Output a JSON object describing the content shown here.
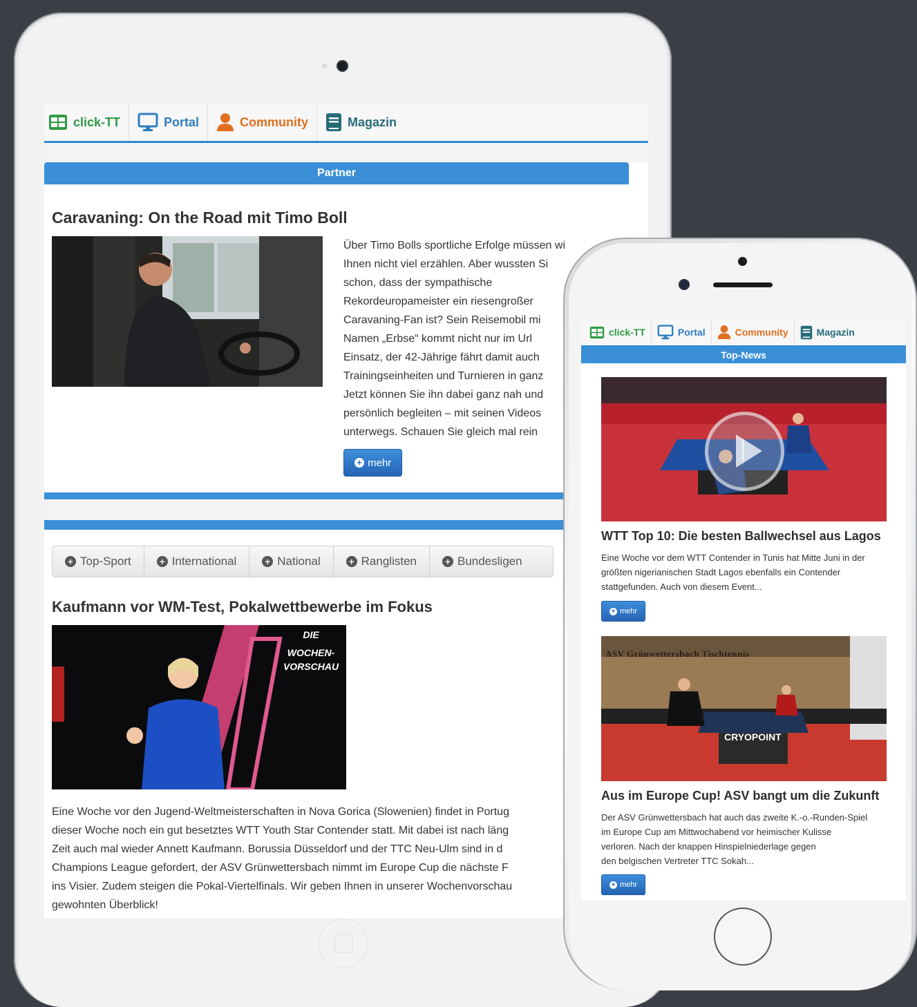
{
  "nav": {
    "items": [
      {
        "label": "click-TT",
        "icon": "grid-icon",
        "color": "#2e9a44"
      },
      {
        "label": "Portal",
        "icon": "monitor-icon",
        "color": "#2e7dbf"
      },
      {
        "label": "Community",
        "icon": "user-icon",
        "color": "#e06f1f"
      },
      {
        "label": "Magazin",
        "icon": "book-icon",
        "color": "#276b7a"
      }
    ]
  },
  "tablet": {
    "partner_header": "Partner",
    "article1": {
      "title": "Caravaning: On the Road mit Timo Boll",
      "lines": [
        "Über Timo Bolls sportliche Erfolge müssen wi",
        "Ihnen nicht viel erzählen. Aber wussten Si",
        "schon, dass der sympathische",
        "Rekordeuropameister ein riesengroßer",
        "Caravaning-Fan ist? Sein Reisemobil mi",
        "Namen „Erbse“ kommt nicht nur im Url",
        "Einsatz, der 42-Jährige fährt damit auch",
        "Trainingseinheiten und Turnieren in ganz",
        "Jetzt können Sie ihn dabei ganz nah und",
        "persönlich begleiten – mit seinen Videos",
        "unterwegs. Schauen Sie gleich mal rein"
      ],
      "button": "mehr"
    },
    "tabs": [
      "Top-Sport",
      "International",
      "National",
      "Ranglisten",
      "Bundesligen"
    ],
    "article2": {
      "title": "Kaufmann vor WM-Test, Pokalwettbewerbe im Fokus",
      "image_caption": [
        "DIE",
        "WOCHEN-",
        "VORSCHAU"
      ],
      "lines": [
        "Eine Woche vor den Jugend-Weltmeisterschaften in Nova Gorica (Slowenien) findet in Portug",
        "dieser Woche noch ein gut besetztes WTT Youth Star Contender statt. Mit dabei ist nach läng",
        "Zeit auch mal wieder Annett Kaufmann. Borussia Düsseldorf und der TTC Neu-Ulm sind in d",
        "Champions League gefordert, der ASV Grünwettersbach nimmt im Europe Cup die nächste F",
        "ins Visier. Zudem steigen die Pokal-Viertelfinals. Wir geben Ihnen in unserer Wochenvorschau",
        "gewohnten Überblick!"
      ]
    }
  },
  "phone": {
    "header": "Top-News",
    "news": [
      {
        "title": "WTT Top 10: Die besten Ballwechsel aus Lagos",
        "lines": [
          "Eine Woche vor dem WTT Contender in Tunis hat Mitte Juni in der",
          "größten nigerianischen Stadt Lagos ebenfalls ein Contender",
          "stattgefunden. Auch von diesem Event..."
        ],
        "button": "mehr"
      },
      {
        "title": "Aus im Europe Cup! ASV bangt um die Zukunft",
        "image_banner": "ASV Grünwettersbach Tischtennis",
        "image_sign": "CRYOPOINT",
        "lines": [
          "Der ASV Grünwettersbach hat auch das zweite K.-o.-Runden-Spiel",
          "im Europe Cup am Mittwochabend vor heimischer Kulisse",
          "verloren. Nach der knappen Hinspielniederlage gegen",
          "den belgischen Vertreter TTC Sokah..."
        ],
        "button": "mehr"
      }
    ]
  }
}
